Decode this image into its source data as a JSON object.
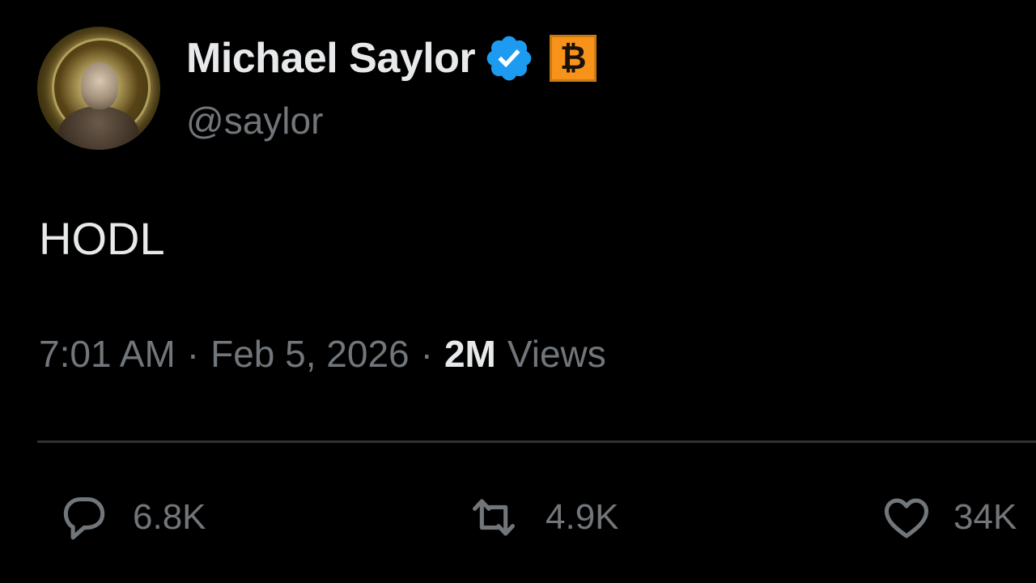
{
  "author": {
    "display_name": "Michael Saylor",
    "handle": "@saylor",
    "verified_icon": "verified-badge-icon",
    "badge_icon": "bitcoin-icon",
    "badge_glyph": "₿",
    "colors": {
      "verified": "#1d9bf0",
      "badge_background": "#f7931a"
    }
  },
  "tweet": {
    "text": "HODL",
    "time": "7:01 AM",
    "separator_1": "·",
    "date": "Feb 5, 2026",
    "separator_2": "·",
    "views_count": "2M",
    "views_label": "Views"
  },
  "actions": {
    "reply": {
      "icon": "reply-icon",
      "count": "6.8K"
    },
    "retweet": {
      "icon": "retweet-icon",
      "count": "4.9K"
    },
    "like": {
      "icon": "heart-icon",
      "count": "34K"
    }
  },
  "theme": {
    "background": "#000000",
    "primary_text": "#e7e9ea",
    "secondary_text": "#71767b",
    "divider": "#2f3336"
  }
}
